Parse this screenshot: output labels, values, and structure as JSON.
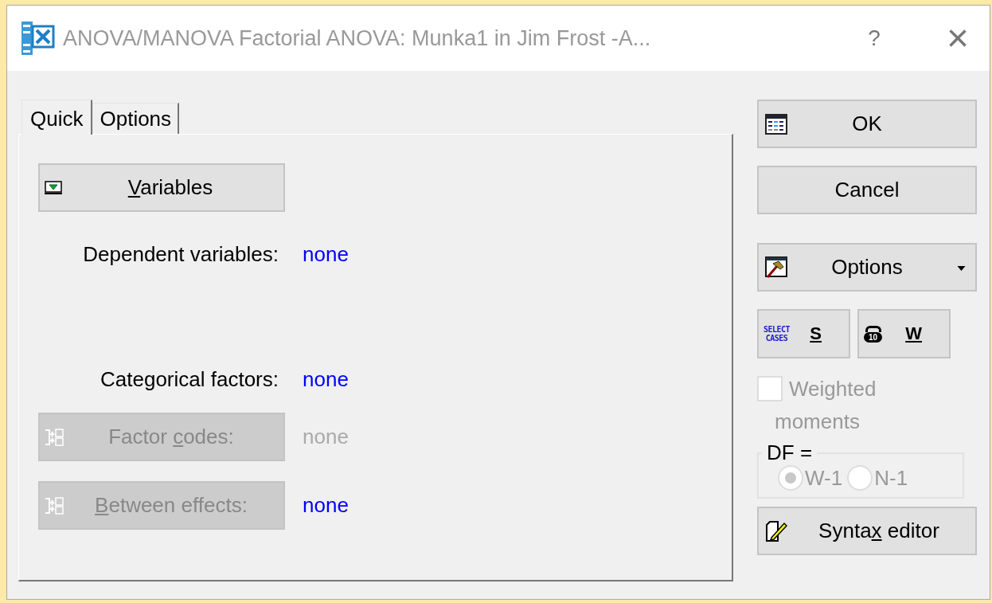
{
  "window": {
    "title": "ANOVA/MANOVA Factorial ANOVA: Munka1 in Jim Frost -A...",
    "help": "?",
    "close": "×"
  },
  "tabs": [
    {
      "label": "Quick",
      "selected": true
    },
    {
      "label": "Options",
      "selected": false
    }
  ],
  "variables_button": {
    "accel": "V",
    "after": "ariables",
    "disabled": false
  },
  "dependent": {
    "label": "Dependent variables:",
    "value": "none",
    "disabled": false
  },
  "categorical": {
    "label": "Categorical factors:",
    "value": "none",
    "disabled": false
  },
  "factor_codes": {
    "before": "Factor ",
    "accel": "c",
    "after": "odes:",
    "disabled": true,
    "value": "none",
    "value_disabled": true
  },
  "between_effects": {
    "accel": "B",
    "after": "etween effects:",
    "disabled": true,
    "value": "none",
    "value_disabled": false
  },
  "ok_button": "OK",
  "cancel_button": "Cancel",
  "options_button": "Options",
  "select_cases": {
    "icon_lines": [
      "SELECT",
      "CASES"
    ],
    "label": "S"
  },
  "weight_button": {
    "icon_text": "10",
    "label": "W"
  },
  "weighted_moments": {
    "label": "Weighted",
    "label_2": "moments",
    "checked": false,
    "disabled": true
  },
  "df": {
    "legend": "DF =",
    "options": [
      {
        "label": "W-1",
        "selected": true
      },
      {
        "label": "N-1",
        "selected": false
      }
    ],
    "disabled": true
  },
  "syntax_button": {
    "before": "Synta",
    "accel": "x",
    "after": " editor"
  }
}
